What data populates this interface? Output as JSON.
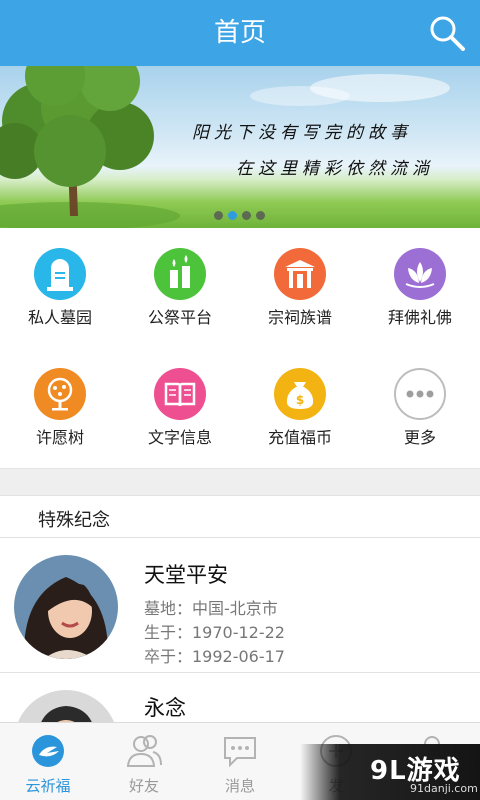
{
  "header": {
    "title": "首页"
  },
  "banner": {
    "line1": "阳光下没有写完的故事",
    "line2": "在这里精彩依然流淌",
    "slide_count": 4,
    "active_slide": 2
  },
  "grid": [
    {
      "label": "私人墓园",
      "icon": "tombstone-icon",
      "color": "#29b6e8"
    },
    {
      "label": "公祭平台",
      "icon": "candles-icon",
      "color": "#4cc33b"
    },
    {
      "label": "宗祠族谱",
      "icon": "temple-gate-icon",
      "color": "#f26a3a"
    },
    {
      "label": "拜佛礼佛",
      "icon": "lotus-icon",
      "color": "#9b6fd4"
    },
    {
      "label": "许愿树",
      "icon": "wish-tree-icon",
      "color": "#f08a23"
    },
    {
      "label": "文字信息",
      "icon": "book-icon",
      "color": "#ee4f91"
    },
    {
      "label": "充值福币",
      "icon": "money-bag-icon",
      "color": "#f3b313"
    },
    {
      "label": "更多",
      "icon": "more-dots-icon",
      "color": "#9e9e9e"
    }
  ],
  "section": {
    "title": "特殊纪念"
  },
  "memorials": [
    {
      "name": "天堂平安",
      "cemetery": "墓地：中国-北京市",
      "born": "生于：1970-12-22",
      "died": "卒于：1992-06-17"
    },
    {
      "name": "永念"
    }
  ],
  "nav": [
    {
      "label": "云祈福",
      "icon": "cloud-pray-icon",
      "active": true
    },
    {
      "label": "好友",
      "icon": "friends-icon",
      "active": false
    },
    {
      "label": "消息",
      "icon": "message-icon",
      "active": false
    },
    {
      "label": "发",
      "icon": "publish-icon",
      "active": false
    },
    {
      "label": "",
      "icon": "profile-icon",
      "active": false
    }
  ],
  "watermark": {
    "main": "9L游戏",
    "sub": "91danji.com"
  },
  "colors": {
    "header": "#3da4e6",
    "nav_active": "#2b95dc"
  }
}
